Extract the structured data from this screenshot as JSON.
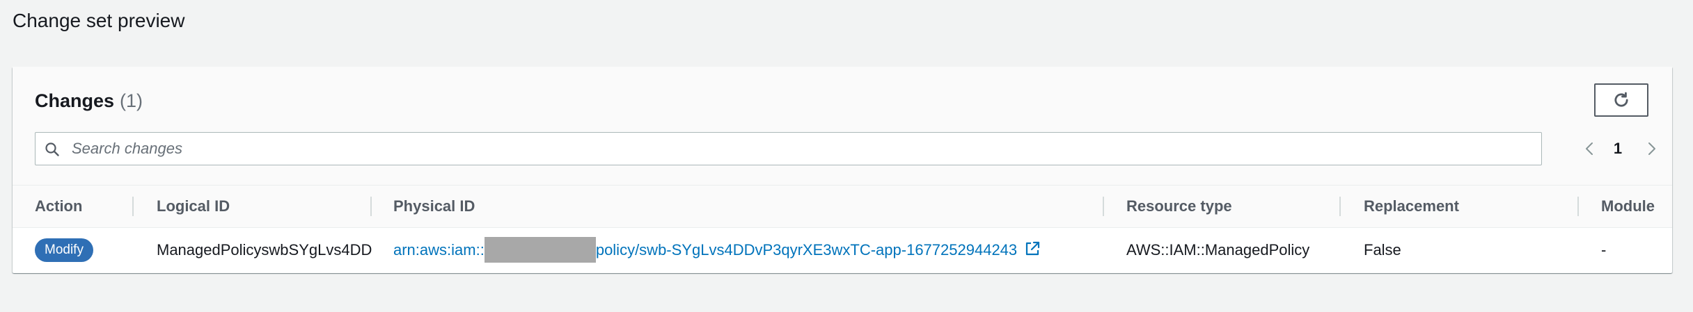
{
  "page": {
    "title": "Change set preview"
  },
  "changes": {
    "title": "Changes",
    "count": "(1)",
    "refresh_icon": "refresh-icon",
    "search": {
      "placeholder": "Search changes",
      "value": ""
    },
    "pagination": {
      "current_page": "1",
      "prev_icon": "chevron-left-icon",
      "next_icon": "chevron-right-icon"
    },
    "columns": [
      "Action",
      "Logical ID",
      "Physical ID",
      "Resource type",
      "Replacement",
      "Module"
    ],
    "rows": [
      {
        "action": "Modify",
        "logical_id": "ManagedPolicyswbSYgLvs4DD",
        "physical_id_prefix": "arn:aws:iam::",
        "physical_id_suffix": "policy/swb-SYgLvs4DDvP3qyrXE3wxTC-app-1677252944243",
        "resource_type": "AWS::IAM::ManagedPolicy",
        "replacement": "False",
        "module": "-"
      }
    ]
  },
  "colors": {
    "page_bg": "#f2f3f3",
    "link": "#0073bb",
    "badge_bg": "#2f6fb5",
    "header_text": "#545b64"
  }
}
